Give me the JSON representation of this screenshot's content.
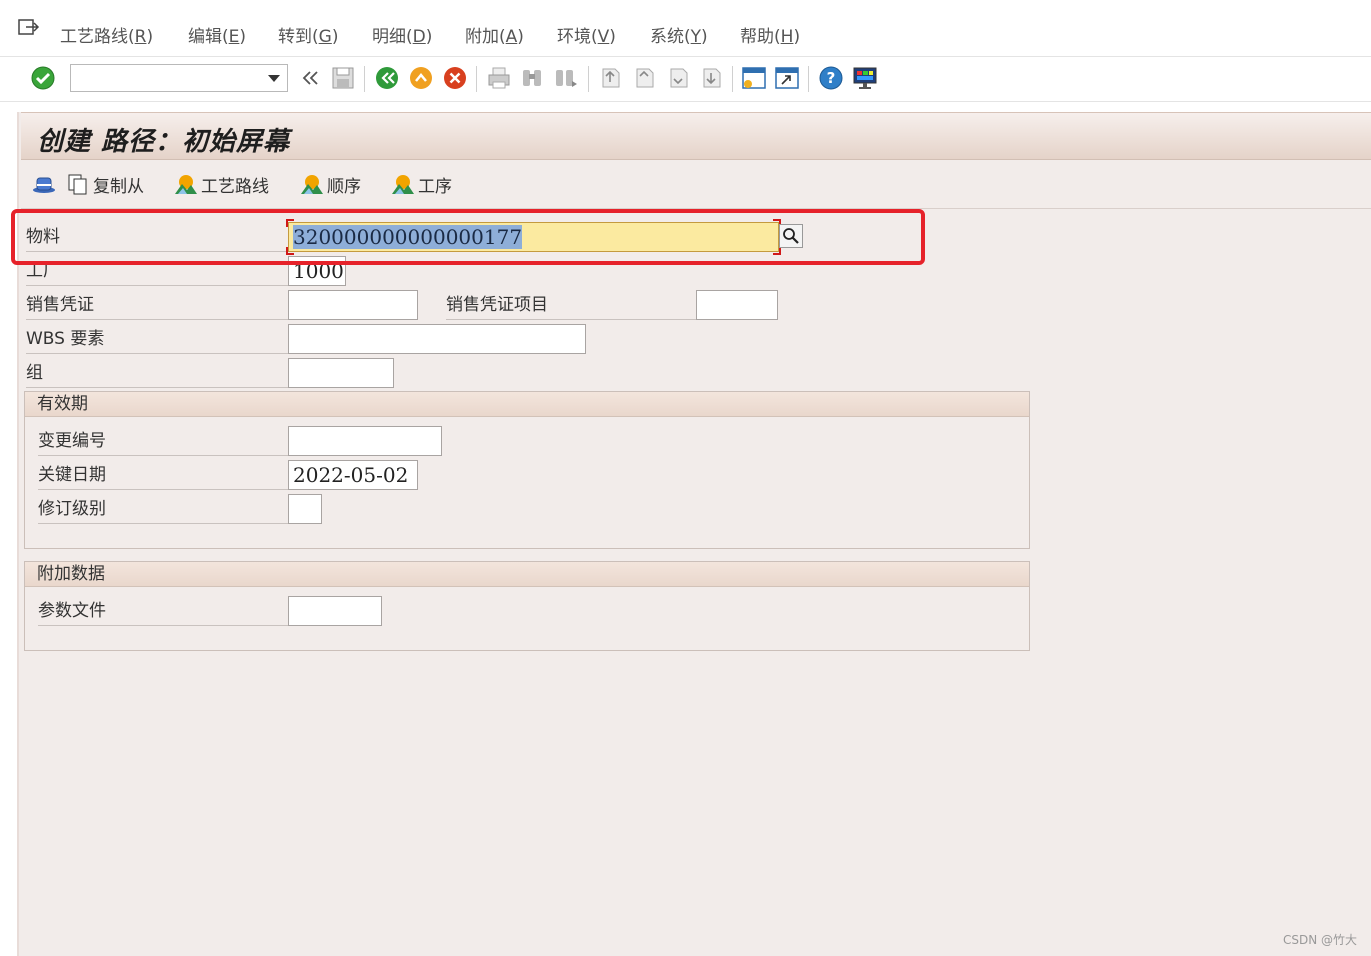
{
  "menu": {
    "items": [
      {
        "label": "工艺路线(",
        "mnemonic": "R",
        "close": ")"
      },
      {
        "label": "编辑(",
        "mnemonic": "E",
        "close": ")"
      },
      {
        "label": "转到(",
        "mnemonic": "G",
        "close": ")"
      },
      {
        "label": "明细(",
        "mnemonic": "D",
        "close": ")"
      },
      {
        "label": "附加(",
        "mnemonic": "A",
        "close": ")"
      },
      {
        "label": "环境(",
        "mnemonic": "V",
        "close": ")"
      },
      {
        "label": "系统(",
        "mnemonic": "Y",
        "close": ")"
      },
      {
        "label": "帮助(",
        "mnemonic": "H",
        "close": ")"
      }
    ]
  },
  "toolbar": {
    "command_value": "",
    "icons": [
      "enter-check-icon",
      "back-double-chevron-icon",
      "save-icon",
      "back-green-icon",
      "exit-orange-icon",
      "cancel-red-icon",
      "print-icon",
      "find-icon",
      "find-next-icon",
      "first-page-icon",
      "previous-page-icon",
      "next-page-icon",
      "last-page-icon",
      "create-session-icon",
      "shortcut-icon",
      "help-icon",
      "layout-settings-icon"
    ]
  },
  "page": {
    "title": "创建 路径：初始屏幕"
  },
  "app_toolbar": {
    "copy_from": "复制从",
    "routing": "工艺路线",
    "sequence": "顺序",
    "operation": "工序"
  },
  "form": {
    "material_label": "物料",
    "material_value": "320000000000000177",
    "plant_label": "工厂",
    "plant_value": "1000",
    "sales_doc_label": "销售凭证",
    "sales_doc_value": "",
    "sales_doc_item_label": "销售凭证项目",
    "sales_doc_item_value": "",
    "wbs_label": "WBS 要素",
    "wbs_value": "",
    "group_label": "组",
    "group_value": ""
  },
  "validity": {
    "title": "有效期",
    "change_no_label": "变更编号",
    "change_no_value": "",
    "key_date_label": "关键日期",
    "key_date_value": "2022-05-02",
    "revision_label": "修订级别",
    "revision_value": ""
  },
  "additional": {
    "title": "附加数据",
    "profile_label": "参数文件",
    "profile_value": ""
  },
  "colors": {
    "highlight": "#e6222a",
    "active_field": "#fbeaa0",
    "selection": "#8eaed8",
    "page_bg": "#f2ecea"
  },
  "watermark": "CSDN @竹大"
}
